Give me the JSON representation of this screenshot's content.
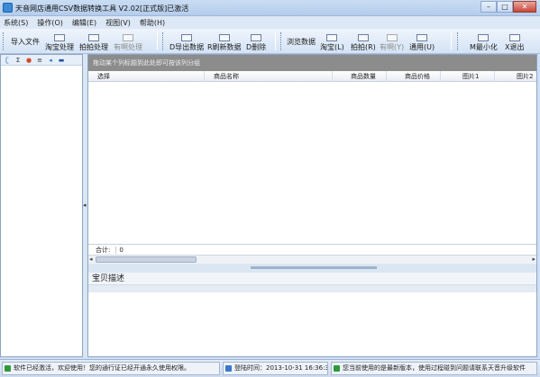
{
  "window": {
    "title": "天音网店通用CSV数据转换工具 V2.02[正式版]已激活",
    "minimize_glyph": "–",
    "maximize_glyph": "□",
    "close_glyph": "✕"
  },
  "menu": [
    "系统(S)",
    "操作(O)",
    "编辑(E)",
    "视图(V)",
    "帮助(H)"
  ],
  "toolbar": {
    "import": "导入文件",
    "taobao_process": "淘宝处理",
    "paipai_process": "拍拍处理",
    "youa_process": "有啊处理",
    "export_data": "D导出数据",
    "refresh_data": "R刷新数据",
    "delete": "D删除",
    "browse_data": "浏览数据",
    "taobao_l": "淘宝(L)",
    "paipai_r": "拍拍(R)",
    "youa_y": "有啊(Y)",
    "general_u": "通用(U)",
    "minimize": "M最小化",
    "exit": "X退出"
  },
  "left_tools": [
    "ʗ",
    "Σ",
    "●",
    "≡",
    "◂",
    "▬"
  ],
  "grid": {
    "group_hint": "拖动某个列标题到此处即可按该列分组",
    "columns": [
      "选择",
      "商品名称",
      "商品数量",
      "商品价格",
      "图片1",
      "图片2"
    ],
    "sum_label": "合计:",
    "sum_value": "0"
  },
  "description": {
    "title": "宝贝描述"
  },
  "status": {
    "activation": "软件已经激活，欢迎使用！您的通行证已经开通永久使用权限。",
    "login_time": "登陆时间：2013-10-31 16:36:32",
    "version_note": "您当前使用的是最新版本，使用过程碰到问题请联系天音升级软件"
  },
  "colors": {
    "status_ok": "#2e9a3a",
    "login_icon": "#3a78c8"
  }
}
